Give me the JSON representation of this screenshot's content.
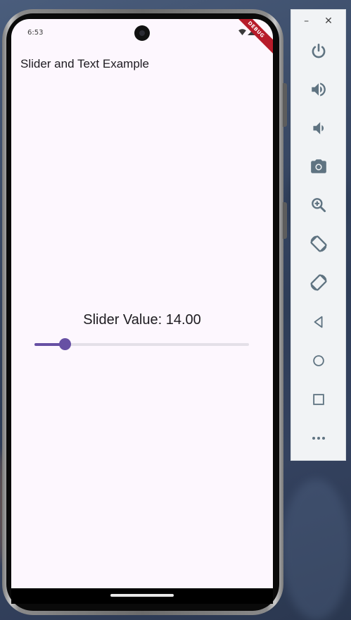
{
  "status_bar": {
    "time": "6:53"
  },
  "debug_banner": "DEBUG",
  "app": {
    "title": "Slider and Text Example",
    "slider_label": "Slider Value: 14.00",
    "slider": {
      "value": 14.0,
      "min": 0,
      "max": 100
    }
  },
  "colors": {
    "screen_background": "#fdf7fe",
    "slider_active": "#6750a4",
    "slider_inactive": "#e4e0e8",
    "toolbar_icon": "#5f7381"
  },
  "emulator_toolbar": {
    "window_controls": {
      "minimize": "–",
      "close": "✕"
    },
    "tools": [
      {
        "icon": "power-icon"
      },
      {
        "icon": "volume-up-icon"
      },
      {
        "icon": "volume-down-icon"
      },
      {
        "icon": "camera-icon"
      },
      {
        "icon": "zoom-in-icon"
      },
      {
        "icon": "rotate-left-icon"
      },
      {
        "icon": "rotate-right-icon"
      },
      {
        "icon": "back-icon"
      },
      {
        "icon": "home-icon"
      },
      {
        "icon": "overview-icon"
      },
      {
        "icon": "more-icon"
      }
    ]
  }
}
